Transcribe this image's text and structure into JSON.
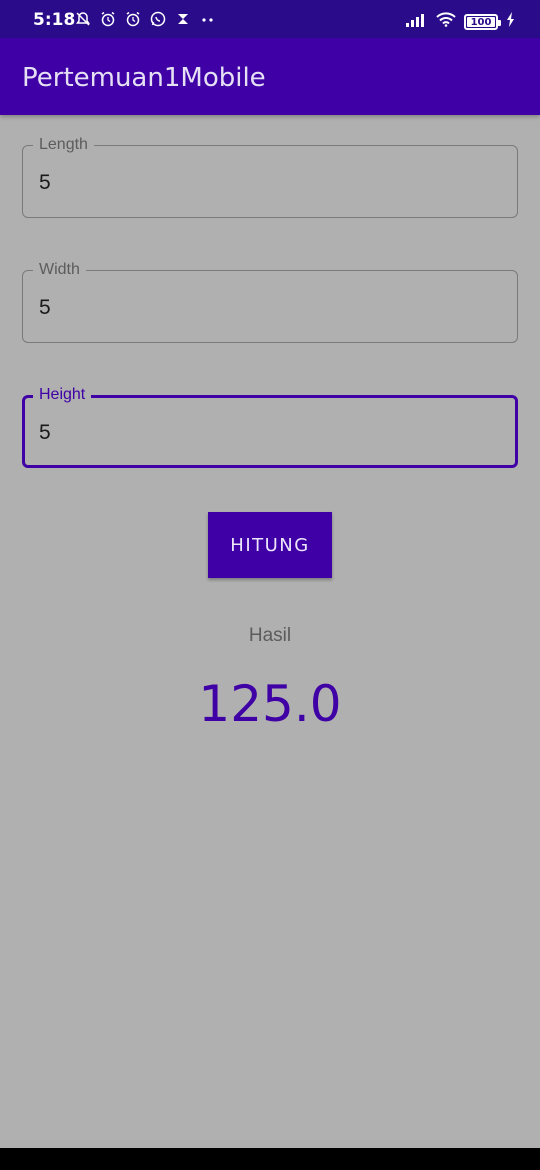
{
  "status_bar": {
    "time": "5:18",
    "battery": "100",
    "left_icons": [
      "muted-bell-icon",
      "alarm-icon",
      "alarm-icon",
      "whatsapp-icon",
      "app-icon",
      "more-dots-icon"
    ],
    "right_icons": [
      "signal-icon",
      "wifi-icon",
      "battery-icon",
      "charging-icon"
    ]
  },
  "app_bar": {
    "title": "Pertemuan1Mobile"
  },
  "fields": {
    "length": {
      "label": "Length",
      "value": "5"
    },
    "width": {
      "label": "Width",
      "value": "5"
    },
    "height": {
      "label": "Height",
      "value": "5"
    }
  },
  "button": {
    "label": "HITUNG"
  },
  "result": {
    "label": "Hasil",
    "value": "125.0"
  },
  "colors": {
    "primary": "#3f00a6",
    "status_bar": "#2a0c8a",
    "background": "#b0b0b0"
  }
}
